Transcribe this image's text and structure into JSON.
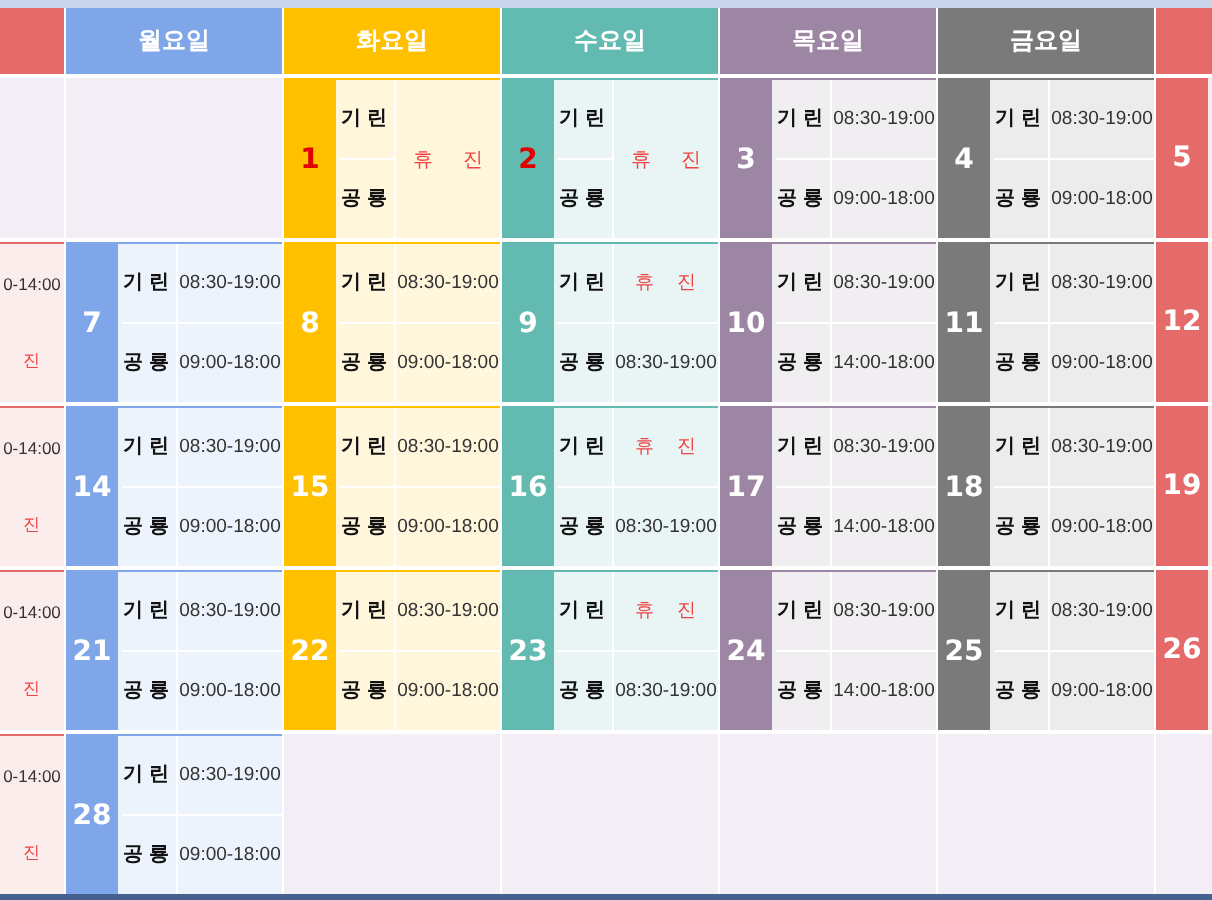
{
  "columns": [
    {
      "color": "#e56b6b"
    },
    {
      "label": "월요일",
      "color": "#7fa6e8"
    },
    {
      "label": "화요일",
      "color": "#ffc000"
    },
    {
      "label": "수요일",
      "color": "#62bab0"
    },
    {
      "label": "목요일",
      "color": "#9d86a3"
    },
    {
      "label": "금요일",
      "color": "#7a7a7a"
    },
    {
      "color": "#e56b6b"
    }
  ],
  "weeks": [
    {
      "days": [
        {
          "kind": "empty"
        },
        {
          "kind": "empty"
        },
        {
          "kind": "closed",
          "number": "1",
          "holiday": true,
          "labels": [
            "기린",
            "공룡"
          ],
          "note": "휴 진"
        },
        {
          "kind": "closed",
          "number": "2",
          "holiday": true,
          "labels": [
            "기린",
            "공룡"
          ],
          "note": "휴 진"
        },
        {
          "kind": "day",
          "number": "3",
          "holiday": false,
          "slots": [
            {
              "label": "기린",
              "value": "08:30-19:00",
              "closed": false
            },
            {
              "label": "공룡",
              "value": "09:00-18:00",
              "closed": false
            }
          ]
        },
        {
          "kind": "day",
          "number": "4",
          "holiday": false,
          "slots": [
            {
              "label": "기린",
              "value": "08:30-19:00",
              "closed": false
            },
            {
              "label": "공룡",
              "value": "09:00-18:00",
              "closed": false
            }
          ]
        },
        {
          "kind": "cut-number",
          "number": "5",
          "holiday": false
        }
      ]
    },
    {
      "days": [
        {
          "kind": "cut",
          "lines": [
            {
              "value": "0-14:00",
              "closed": false
            },
            {
              "value": "진",
              "closed": true
            }
          ]
        },
        {
          "kind": "day",
          "number": "7",
          "holiday": false,
          "slots": [
            {
              "label": "기린",
              "value": "08:30-19:00",
              "closed": false
            },
            {
              "label": "공룡",
              "value": "09:00-18:00",
              "closed": false
            }
          ]
        },
        {
          "kind": "day",
          "number": "8",
          "holiday": false,
          "slots": [
            {
              "label": "기린",
              "value": "08:30-19:00",
              "closed": false
            },
            {
              "label": "공룡",
              "value": "09:00-18:00",
              "closed": false
            }
          ]
        },
        {
          "kind": "day",
          "number": "9",
          "holiday": false,
          "slots": [
            {
              "label": "기린",
              "value": "휴 진",
              "closed": true
            },
            {
              "label": "공룡",
              "value": "08:30-19:00",
              "closed": false
            }
          ]
        },
        {
          "kind": "day",
          "number": "10",
          "holiday": false,
          "slots": [
            {
              "label": "기린",
              "value": "08:30-19:00",
              "closed": false
            },
            {
              "label": "공룡",
              "value": "14:00-18:00",
              "closed": false
            }
          ]
        },
        {
          "kind": "day",
          "number": "11",
          "holiday": false,
          "slots": [
            {
              "label": "기린",
              "value": "08:30-19:00",
              "closed": false
            },
            {
              "label": "공룡",
              "value": "09:00-18:00",
              "closed": false
            }
          ]
        },
        {
          "kind": "cut-number",
          "number": "12",
          "holiday": false
        }
      ]
    },
    {
      "days": [
        {
          "kind": "cut",
          "lines": [
            {
              "value": "0-14:00",
              "closed": false
            },
            {
              "value": "진",
              "closed": true
            }
          ]
        },
        {
          "kind": "day",
          "number": "14",
          "holiday": false,
          "slots": [
            {
              "label": "기린",
              "value": "08:30-19:00",
              "closed": false
            },
            {
              "label": "공룡",
              "value": "09:00-18:00",
              "closed": false
            }
          ]
        },
        {
          "kind": "day",
          "number": "15",
          "holiday": false,
          "slots": [
            {
              "label": "기린",
              "value": "08:30-19:00",
              "closed": false
            },
            {
              "label": "공룡",
              "value": "09:00-18:00",
              "closed": false
            }
          ]
        },
        {
          "kind": "day",
          "number": "16",
          "holiday": false,
          "slots": [
            {
              "label": "기린",
              "value": "휴 진",
              "closed": true
            },
            {
              "label": "공룡",
              "value": "08:30-19:00",
              "closed": false
            }
          ]
        },
        {
          "kind": "day",
          "number": "17",
          "holiday": false,
          "slots": [
            {
              "label": "기린",
              "value": "08:30-19:00",
              "closed": false
            },
            {
              "label": "공룡",
              "value": "14:00-18:00",
              "closed": false
            }
          ]
        },
        {
          "kind": "day",
          "number": "18",
          "holiday": false,
          "slots": [
            {
              "label": "기린",
              "value": "08:30-19:00",
              "closed": false
            },
            {
              "label": "공룡",
              "value": "09:00-18:00",
              "closed": false
            }
          ]
        },
        {
          "kind": "cut-number",
          "number": "19",
          "holiday": false
        }
      ]
    },
    {
      "days": [
        {
          "kind": "cut",
          "lines": [
            {
              "value": "0-14:00",
              "closed": false
            },
            {
              "value": "진",
              "closed": true
            }
          ]
        },
        {
          "kind": "day",
          "number": "21",
          "holiday": false,
          "slots": [
            {
              "label": "기린",
              "value": "08:30-19:00",
              "closed": false
            },
            {
              "label": "공룡",
              "value": "09:00-18:00",
              "closed": false
            }
          ]
        },
        {
          "kind": "day",
          "number": "22",
          "holiday": false,
          "slots": [
            {
              "label": "기린",
              "value": "08:30-19:00",
              "closed": false
            },
            {
              "label": "공룡",
              "value": "09:00-18:00",
              "closed": false
            }
          ]
        },
        {
          "kind": "day",
          "number": "23",
          "holiday": false,
          "slots": [
            {
              "label": "기린",
              "value": "휴 진",
              "closed": true
            },
            {
              "label": "공룡",
              "value": "08:30-19:00",
              "closed": false
            }
          ]
        },
        {
          "kind": "day",
          "number": "24",
          "holiday": false,
          "slots": [
            {
              "label": "기린",
              "value": "08:30-19:00",
              "closed": false
            },
            {
              "label": "공룡",
              "value": "14:00-18:00",
              "closed": false
            }
          ]
        },
        {
          "kind": "day",
          "number": "25",
          "holiday": false,
          "slots": [
            {
              "label": "기린",
              "value": "08:30-19:00",
              "closed": false
            },
            {
              "label": "공룡",
              "value": "09:00-18:00",
              "closed": false
            }
          ]
        },
        {
          "kind": "cut-number",
          "number": "26",
          "holiday": false
        }
      ]
    },
    {
      "days": [
        {
          "kind": "cut",
          "lines": [
            {
              "value": "0-14:00",
              "closed": false
            },
            {
              "value": "진",
              "closed": true
            }
          ]
        },
        {
          "kind": "day",
          "number": "28",
          "holiday": false,
          "slots": [
            {
              "label": "기린",
              "value": "08:30-19:00",
              "closed": false
            },
            {
              "label": "공룡",
              "value": "09:00-18:00",
              "closed": false
            }
          ]
        },
        {
          "kind": "empty"
        },
        {
          "kind": "empty"
        },
        {
          "kind": "empty"
        },
        {
          "kind": "empty"
        },
        {
          "kind": "empty"
        }
      ]
    }
  ]
}
